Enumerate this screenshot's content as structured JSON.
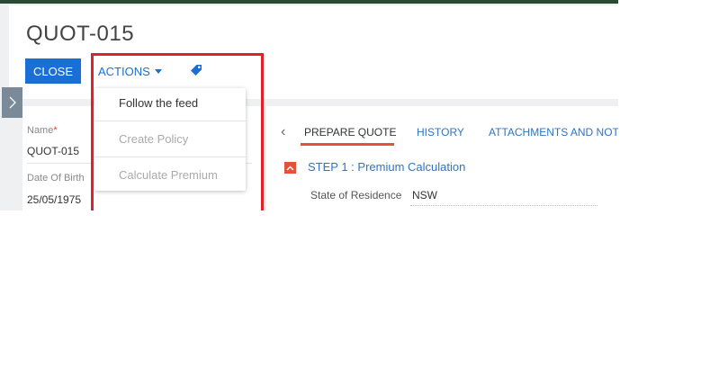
{
  "record": {
    "title": "QUOT-015"
  },
  "toolbar": {
    "close_label": "CLOSE",
    "actions_label": "ACTIONS",
    "tag_icon": "tag-icon"
  },
  "actions_menu": {
    "items": [
      {
        "label": "Follow the feed",
        "enabled": true
      },
      {
        "label": "Create Policy",
        "enabled": false
      },
      {
        "label": "Calculate Premium",
        "enabled": false
      }
    ]
  },
  "left_panel": {
    "fields": [
      {
        "label": "Name",
        "required": true,
        "value": "QUOT-015"
      },
      {
        "label": "Date Of Birth",
        "required": false,
        "value": "25/05/1975"
      }
    ]
  },
  "right_panel": {
    "tabs": [
      {
        "label": "PREPARE QUOTE",
        "active": true
      },
      {
        "label": "HISTORY",
        "active": false
      },
      {
        "label": "ATTACHMENTS AND NOT",
        "active": false
      }
    ],
    "step_title": "STEP 1 : Premium Calculation",
    "state_of_residence": {
      "label": "State of Residence",
      "value": "NSW"
    }
  },
  "colors": {
    "primary": "#1a6fd6",
    "accent": "#e2523b",
    "highlight_border": "#e0202a",
    "top_strip": "#2b4a34"
  }
}
